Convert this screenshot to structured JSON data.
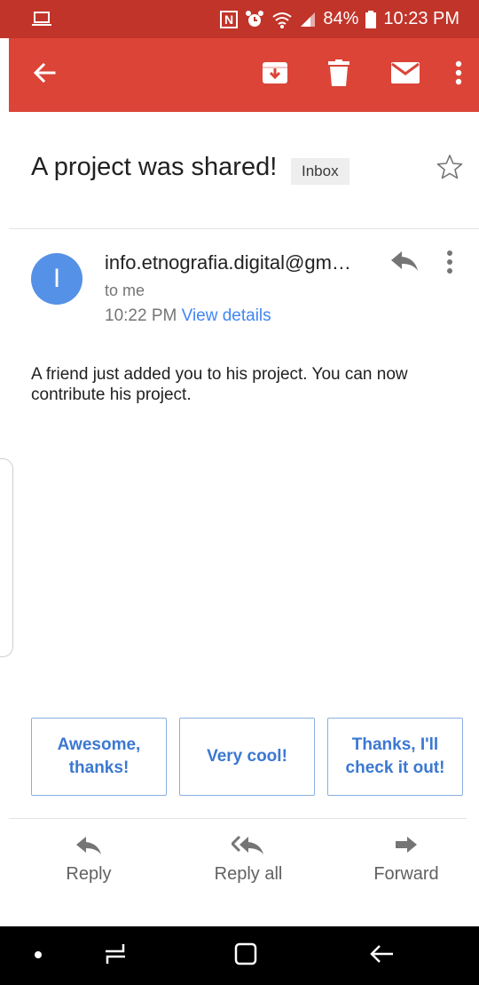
{
  "status_bar": {
    "battery": "84%",
    "time": "10:23 PM",
    "icons": [
      "laptop-icon",
      "nfc-icon",
      "alarm-icon",
      "wifi-icon",
      "signal-icon",
      "battery-icon"
    ]
  },
  "app_bar": {
    "color": "#db4437",
    "actions": [
      "back-arrow-icon",
      "archive-icon",
      "delete-icon",
      "mark-unread-icon",
      "more-vert-icon"
    ]
  },
  "email": {
    "subject": "A project was shared!",
    "label": "Inbox",
    "sender_initial": "I",
    "sender": "info.etnografia.digital@gm…",
    "recipient": "to me",
    "time": "10:22 PM",
    "view_details": "View details",
    "body": "A friend just added you to his project. You can now contribute his project."
  },
  "smart_replies": [
    "Awesome, thanks!",
    "Very cool!",
    "Thanks, I'll check it out!"
  ],
  "actions": {
    "reply": "Reply",
    "reply_all": "Reply all",
    "forward": "Forward"
  }
}
